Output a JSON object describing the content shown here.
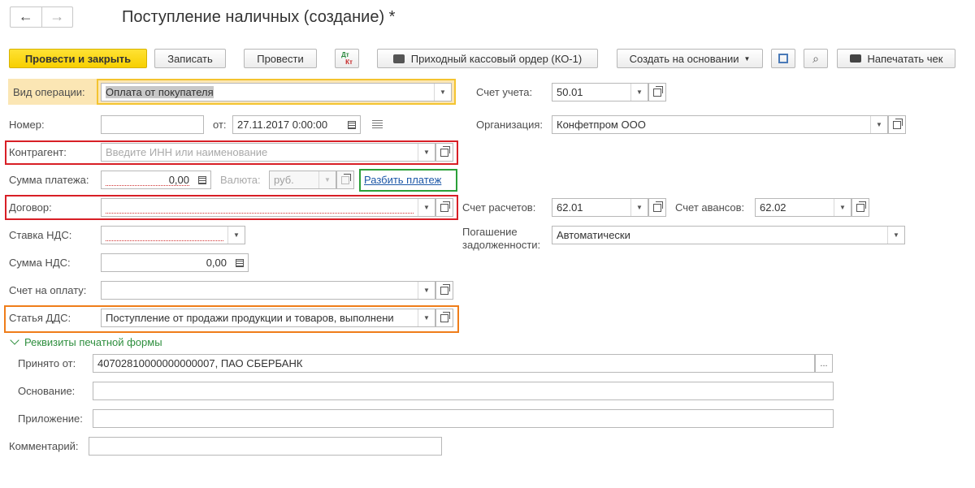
{
  "nav": {
    "back": "←",
    "forward": "→"
  },
  "title": "Поступление наличных (создание) *",
  "toolbar": {
    "post_close": "Провести и закрыть",
    "save": "Записать",
    "post": "Провести",
    "dt_kt_top": "Дт",
    "dt_kt_bottom": "Кт",
    "print_order": "Приходный кассовый ордер (КО-1)",
    "create_based": "Создать на основании",
    "print_check": "Напечатать чек"
  },
  "form": {
    "operation_type": {
      "label": "Вид операции:",
      "value": "Оплата от покупателя"
    },
    "number": {
      "label": "Номер:",
      "value": ""
    },
    "date": {
      "label": "от:",
      "value": "27.11.2017  0:00:00"
    },
    "account": {
      "label": "Счет учета:",
      "value": "50.01"
    },
    "organization": {
      "label": "Организация:",
      "value": "Конфетпром ООО"
    },
    "counterparty": {
      "label": "Контрагент:",
      "placeholder": "Введите ИНН или наименование"
    },
    "payment_sum": {
      "label": "Сумма платежа:",
      "value": "0,00"
    },
    "currency": {
      "label": "Валюта:",
      "value": "руб."
    },
    "split_payment": "Разбить платеж",
    "contract": {
      "label": "Договор:",
      "value": ""
    },
    "settlement_account": {
      "label": "Счет расчетов:",
      "value": "62.01"
    },
    "advance_account": {
      "label": "Счет авансов:",
      "value": "62.02"
    },
    "vat_rate": {
      "label": "Ставка НДС:",
      "value": ""
    },
    "debt_repayment": {
      "label_line1": "Погашение",
      "label_line2": "задолженности:",
      "value": "Автоматически"
    },
    "vat_sum": {
      "label": "Сумма НДС:",
      "value": "0,00"
    },
    "invoice": {
      "label": "Счет на оплату:",
      "value": ""
    },
    "cash_flow_item": {
      "label": "Статья ДДС:",
      "value": "Поступление от продажи продукции и товаров, выполнени"
    },
    "print_section": "Реквизиты печатной формы",
    "received_from": {
      "label": "Принято от:",
      "value": "40702810000000000007, ПАО СБЕРБАНК",
      "button": "..."
    },
    "basis": {
      "label": "Основание:",
      "value": ""
    },
    "attachment": {
      "label": "Приложение:",
      "value": ""
    },
    "comment": {
      "label": "Комментарий:",
      "value": ""
    }
  },
  "colors": {
    "primary_button": "#f7cf00",
    "operation_highlight": "#fbe6b4",
    "frame_red": "#d81f26",
    "frame_green": "#2aa039",
    "frame_orange": "#ef7d1a",
    "frame_yellow": "#f4c430",
    "link": "#1c57a7"
  }
}
